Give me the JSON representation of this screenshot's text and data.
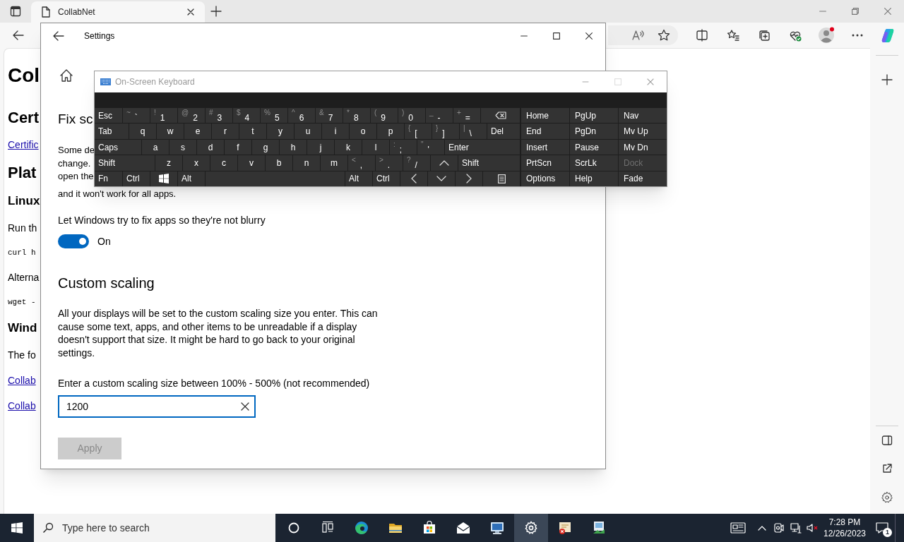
{
  "browser": {
    "tabs": [
      {
        "title": "CollabNet",
        "selected": true
      }
    ],
    "page": [
      {
        "kind": "h1",
        "text": "Col"
      },
      {
        "kind": "h2",
        "text": "Cert"
      },
      {
        "kind": "link",
        "text": "Certific"
      },
      {
        "kind": "h2",
        "text": "Plat"
      },
      {
        "kind": "h3",
        "text": "Linux"
      },
      {
        "kind": "p",
        "text": "Run th"
      },
      {
        "kind": "code",
        "text": "curl h"
      },
      {
        "kind": "p",
        "text": "Alterna"
      },
      {
        "kind": "code",
        "text": "wget -"
      },
      {
        "kind": "h3",
        "text": "Wind"
      },
      {
        "kind": "p",
        "text": "The fo"
      },
      {
        "kind": "link",
        "text": "Collab"
      },
      {
        "kind": "link",
        "text": "Collab"
      }
    ]
  },
  "settings": {
    "title": "Settings",
    "section_1": {
      "title": "Fix sc",
      "lines": [
        "Some de",
        "change.",
        "open the",
        "and it won't work for all apps."
      ],
      "toggle_label": "Let Windows try to fix apps so they're not blurry",
      "toggle": {
        "on": true,
        "label": "On"
      }
    },
    "section_2": {
      "title": "Custom scaling",
      "description": "All your displays will be set to the custom scaling size you enter. This can cause some text, apps, and other items to be unreadable if a display doesn't support that size. It might be hard to go back to your original settings.",
      "input_label": "Enter a custom scaling size between 100% - 500% (not recommended)",
      "input_value": "1200",
      "apply": {
        "label": "Apply",
        "disabled": true
      }
    }
  },
  "keyboard": {
    "title": "On-Screen Keyboard",
    "main_rows": [
      [
        {
          "label": "Esc"
        },
        {
          "label": "`",
          "shift": "~"
        },
        {
          "label": "1",
          "shift": "!"
        },
        {
          "label": "2",
          "shift": "@"
        },
        {
          "label": "3",
          "shift": "#"
        },
        {
          "label": "4",
          "shift": "$"
        },
        {
          "label": "5",
          "shift": "%"
        },
        {
          "label": "6",
          "shift": "^"
        },
        {
          "label": "7",
          "shift": "&"
        },
        {
          "label": "8",
          "shift": "*"
        },
        {
          "label": "9",
          "shift": "("
        },
        {
          "label": "0",
          "shift": ")"
        },
        {
          "label": "-",
          "shift": "_"
        },
        {
          "label": "=",
          "shift": "+"
        },
        {
          "kind": "backspace"
        }
      ],
      [
        {
          "label": "Tab"
        },
        {
          "label": "q"
        },
        {
          "label": "w"
        },
        {
          "label": "e"
        },
        {
          "label": "r"
        },
        {
          "label": "t"
        },
        {
          "label": "y"
        },
        {
          "label": "u"
        },
        {
          "label": "i"
        },
        {
          "label": "o"
        },
        {
          "label": "p"
        },
        {
          "label": "[",
          "shift": "{"
        },
        {
          "label": "]",
          "shift": "}"
        },
        {
          "label": "\\",
          "shift": "|"
        },
        {
          "label": "Del"
        }
      ],
      [
        {
          "label": "Caps"
        },
        {
          "label": "a"
        },
        {
          "label": "s"
        },
        {
          "label": "d"
        },
        {
          "label": "f"
        },
        {
          "label": "g"
        },
        {
          "label": "h"
        },
        {
          "label": "j"
        },
        {
          "label": "k"
        },
        {
          "label": "l"
        },
        {
          "label": ";",
          "shift": ":"
        },
        {
          "label": "'",
          "shift": "\""
        },
        {
          "label": "Enter"
        }
      ],
      [
        {
          "label": "Shift"
        },
        {
          "label": "z"
        },
        {
          "label": "x"
        },
        {
          "label": "c"
        },
        {
          "label": "v"
        },
        {
          "label": "b"
        },
        {
          "label": "n"
        },
        {
          "label": "m"
        },
        {
          "label": ",",
          "shift": "<"
        },
        {
          "label": ".",
          "shift": ">"
        },
        {
          "label": "/",
          "shift": "?"
        },
        {
          "kind": "up"
        },
        {
          "label": "Shift"
        }
      ],
      [
        {
          "label": "Fn"
        },
        {
          "label": "Ctrl"
        },
        {
          "kind": "windows"
        },
        {
          "label": "Alt"
        },
        {
          "kind": "space"
        },
        {
          "label": "Alt"
        },
        {
          "label": "Ctrl"
        },
        {
          "kind": "left"
        },
        {
          "kind": "down"
        },
        {
          "kind": "right"
        },
        {
          "kind": "menu"
        }
      ]
    ],
    "side_rows": [
      [
        {
          "label": "Home",
          "disabled": false
        },
        {
          "label": "PgUp",
          "disabled": false
        },
        {
          "label": "Nav",
          "disabled": false
        }
      ],
      [
        {
          "label": "End",
          "disabled": false
        },
        {
          "label": "PgDn",
          "disabled": false
        },
        {
          "label": "Mv Up",
          "disabled": false
        }
      ],
      [
        {
          "label": "Insert",
          "disabled": false
        },
        {
          "label": "Pause",
          "disabled": false
        },
        {
          "label": "Mv Dn",
          "disabled": false
        }
      ],
      [
        {
          "label": "PrtScn",
          "disabled": false
        },
        {
          "label": "ScrLk",
          "disabled": false
        },
        {
          "label": "Dock",
          "disabled": true
        }
      ],
      [
        {
          "label": "Options",
          "disabled": false
        },
        {
          "label": "Help",
          "disabled": false
        },
        {
          "label": "Fade",
          "disabled": false
        }
      ]
    ]
  },
  "taskbar": {
    "search_placeholder": "Type here to search",
    "apps": [
      {
        "kind": "cortana",
        "selected": false
      },
      {
        "kind": "taskview",
        "selected": false
      },
      {
        "kind": "edge",
        "selected": false
      },
      {
        "kind": "folder",
        "selected": false
      },
      {
        "kind": "store",
        "selected": false
      },
      {
        "kind": "mail",
        "selected": false
      },
      {
        "kind": "monitor",
        "selected": false
      },
      {
        "kind": "settings",
        "selected": true
      },
      {
        "kind": "certificate",
        "selected": false
      },
      {
        "kind": "document",
        "selected": false
      }
    ],
    "time": "7:28 PM",
    "date": "12/26/2023",
    "notification_count": "1"
  }
}
